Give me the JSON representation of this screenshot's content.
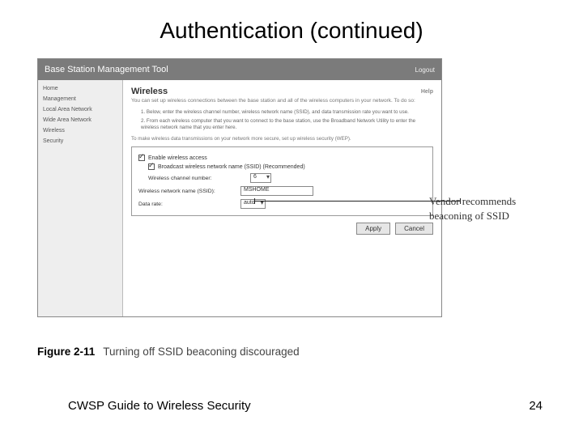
{
  "title": "Authentication (continued)",
  "app": {
    "title": "Base Station Management Tool",
    "logout": "Logout",
    "sidebar": {
      "items": [
        "Home",
        "Management",
        "Local Area Network",
        "Wide Area Network",
        "Wireless",
        "Security"
      ]
    },
    "content": {
      "heading": "Wireless",
      "help": "Help",
      "sub": "You can set up wireless connections between the base station and all of the wireless computers in your network. To do so:",
      "step1": "1.  Below, enter the wireless channel number, wireless network name (SSID), and data transmission rate you want to use.",
      "step2": "2.  From each wireless computer that you want to connect to the base station, use the Broadband Network Utility to enter the wireless network name that you enter here.",
      "hint": "To make wireless data transmissions on your network more secure, set up wireless security (WEP).",
      "enable_label": "Enable wireless access",
      "broadcast_label": "Broadcast wireless network name (SSID) (Recommended)",
      "channel_label": "Wireless channel number:",
      "channel_value": "6",
      "ssid_label": "Wireless network name (SSID):",
      "ssid_value": "MSHOME",
      "rate_label": "Data rate:",
      "rate_value": "auto",
      "apply": "Apply",
      "cancel": "Cancel"
    }
  },
  "callout": "Vendor recommends beaconing of SSID",
  "figure": {
    "label": "Figure 2-11",
    "caption": "Turning off SSID beaconing discouraged"
  },
  "footer": {
    "left": "CWSP Guide to Wireless Security",
    "right": "24"
  }
}
